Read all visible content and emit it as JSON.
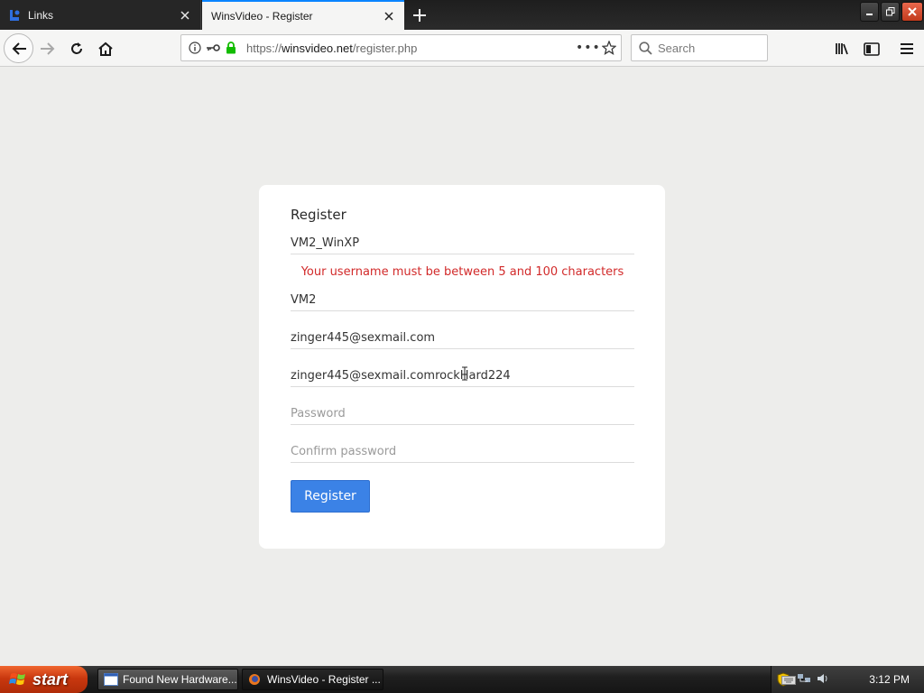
{
  "browser": {
    "tabs": [
      {
        "title": "Links",
        "active": false
      },
      {
        "title": "WinsVideo - Register",
        "active": true
      }
    ],
    "url": {
      "scheme": "https://",
      "host": "winsvideo.net",
      "path": "/register.php"
    },
    "search_placeholder": "Search",
    "accent_color": "#0a84ff"
  },
  "form": {
    "title": "Register",
    "username_value": "VM2_WinXP",
    "error_message": "Your username must be between 5 and 100 characters",
    "name_value": "VM2",
    "email_value": "zinger445@sexmail.com",
    "email_confirm_value": "zinger445@sexmail.comrockHard224",
    "password_placeholder": "Password",
    "confirm_password_placeholder": "Confirm password",
    "submit_label": "Register",
    "button_color": "#3b82e6",
    "error_color": "#d22a2a"
  },
  "taskbar": {
    "start_label": "start",
    "tasks": [
      {
        "label": "Found New Hardware..."
      },
      {
        "label": "WinsVideo - Register ..."
      }
    ],
    "clock": "3:12 PM"
  }
}
